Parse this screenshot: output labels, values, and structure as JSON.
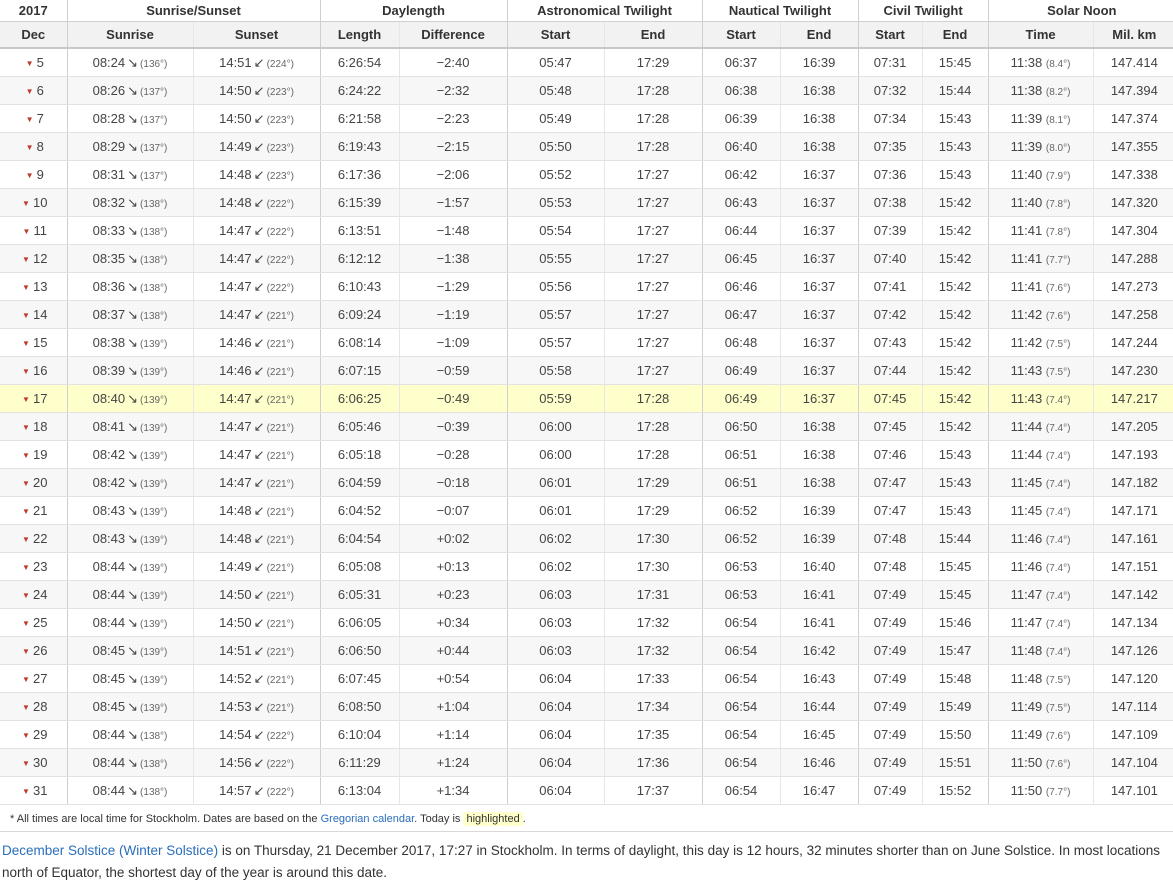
{
  "header": {
    "year": "2017",
    "groups": [
      "Sunrise/Sunset",
      "Daylength",
      "Astronomical Twilight",
      "Nautical Twilight",
      "Civil Twilight",
      "Solar Noon"
    ],
    "month": "Dec",
    "cols": [
      "Sunrise",
      "Sunset",
      "Length",
      "Difference",
      "Start",
      "End",
      "Start",
      "End",
      "Start",
      "End",
      "Time",
      "Mil. km"
    ]
  },
  "rows": [
    {
      "day": "5",
      "sr": "08:24",
      "srd": "(136°)",
      "ss": "14:51",
      "ssd": "(224°)",
      "len": "6:26:54",
      "diff": "−2:40",
      "as": "05:47",
      "ae": "17:29",
      "ns": "06:37",
      "ne": "16:39",
      "cs": "07:31",
      "ce": "15:45",
      "noon": "11:38",
      "nd": "(8.4°)",
      "km": "147.414"
    },
    {
      "day": "6",
      "sr": "08:26",
      "srd": "(137°)",
      "ss": "14:50",
      "ssd": "(223°)",
      "len": "6:24:22",
      "diff": "−2:32",
      "as": "05:48",
      "ae": "17:28",
      "ns": "06:38",
      "ne": "16:38",
      "cs": "07:32",
      "ce": "15:44",
      "noon": "11:38",
      "nd": "(8.2°)",
      "km": "147.394"
    },
    {
      "day": "7",
      "sr": "08:28",
      "srd": "(137°)",
      "ss": "14:50",
      "ssd": "(223°)",
      "len": "6:21:58",
      "diff": "−2:23",
      "as": "05:49",
      "ae": "17:28",
      "ns": "06:39",
      "ne": "16:38",
      "cs": "07:34",
      "ce": "15:43",
      "noon": "11:39",
      "nd": "(8.1°)",
      "km": "147.374"
    },
    {
      "day": "8",
      "sr": "08:29",
      "srd": "(137°)",
      "ss": "14:49",
      "ssd": "(223°)",
      "len": "6:19:43",
      "diff": "−2:15",
      "as": "05:50",
      "ae": "17:28",
      "ns": "06:40",
      "ne": "16:38",
      "cs": "07:35",
      "ce": "15:43",
      "noon": "11:39",
      "nd": "(8.0°)",
      "km": "147.355"
    },
    {
      "day": "9",
      "sr": "08:31",
      "srd": "(137°)",
      "ss": "14:48",
      "ssd": "(223°)",
      "len": "6:17:36",
      "diff": "−2:06",
      "as": "05:52",
      "ae": "17:27",
      "ns": "06:42",
      "ne": "16:37",
      "cs": "07:36",
      "ce": "15:43",
      "noon": "11:40",
      "nd": "(7.9°)",
      "km": "147.338"
    },
    {
      "day": "10",
      "sr": "08:32",
      "srd": "(138°)",
      "ss": "14:48",
      "ssd": "(222°)",
      "len": "6:15:39",
      "diff": "−1:57",
      "as": "05:53",
      "ae": "17:27",
      "ns": "06:43",
      "ne": "16:37",
      "cs": "07:38",
      "ce": "15:42",
      "noon": "11:40",
      "nd": "(7.8°)",
      "km": "147.320"
    },
    {
      "day": "11",
      "sr": "08:33",
      "srd": "(138°)",
      "ss": "14:47",
      "ssd": "(222°)",
      "len": "6:13:51",
      "diff": "−1:48",
      "as": "05:54",
      "ae": "17:27",
      "ns": "06:44",
      "ne": "16:37",
      "cs": "07:39",
      "ce": "15:42",
      "noon": "11:41",
      "nd": "(7.8°)",
      "km": "147.304"
    },
    {
      "day": "12",
      "sr": "08:35",
      "srd": "(138°)",
      "ss": "14:47",
      "ssd": "(222°)",
      "len": "6:12:12",
      "diff": "−1:38",
      "as": "05:55",
      "ae": "17:27",
      "ns": "06:45",
      "ne": "16:37",
      "cs": "07:40",
      "ce": "15:42",
      "noon": "11:41",
      "nd": "(7.7°)",
      "km": "147.288"
    },
    {
      "day": "13",
      "sr": "08:36",
      "srd": "(138°)",
      "ss": "14:47",
      "ssd": "(222°)",
      "len": "6:10:43",
      "diff": "−1:29",
      "as": "05:56",
      "ae": "17:27",
      "ns": "06:46",
      "ne": "16:37",
      "cs": "07:41",
      "ce": "15:42",
      "noon": "11:41",
      "nd": "(7.6°)",
      "km": "147.273"
    },
    {
      "day": "14",
      "sr": "08:37",
      "srd": "(138°)",
      "ss": "14:47",
      "ssd": "(221°)",
      "len": "6:09:24",
      "diff": "−1:19",
      "as": "05:57",
      "ae": "17:27",
      "ns": "06:47",
      "ne": "16:37",
      "cs": "07:42",
      "ce": "15:42",
      "noon": "11:42",
      "nd": "(7.6°)",
      "km": "147.258"
    },
    {
      "day": "15",
      "sr": "08:38",
      "srd": "(139°)",
      "ss": "14:46",
      "ssd": "(221°)",
      "len": "6:08:14",
      "diff": "−1:09",
      "as": "05:57",
      "ae": "17:27",
      "ns": "06:48",
      "ne": "16:37",
      "cs": "07:43",
      "ce": "15:42",
      "noon": "11:42",
      "nd": "(7.5°)",
      "km": "147.244"
    },
    {
      "day": "16",
      "sr": "08:39",
      "srd": "(139°)",
      "ss": "14:46",
      "ssd": "(221°)",
      "len": "6:07:15",
      "diff": "−0:59",
      "as": "05:58",
      "ae": "17:27",
      "ns": "06:49",
      "ne": "16:37",
      "cs": "07:44",
      "ce": "15:42",
      "noon": "11:43",
      "nd": "(7.5°)",
      "km": "147.230"
    },
    {
      "day": "17",
      "sr": "08:40",
      "srd": "(139°)",
      "ss": "14:47",
      "ssd": "(221°)",
      "len": "6:06:25",
      "diff": "−0:49",
      "as": "05:59",
      "ae": "17:28",
      "ns": "06:49",
      "ne": "16:37",
      "cs": "07:45",
      "ce": "15:42",
      "noon": "11:43",
      "nd": "(7.4°)",
      "km": "147.217",
      "highlight": true
    },
    {
      "day": "18",
      "sr": "08:41",
      "srd": "(139°)",
      "ss": "14:47",
      "ssd": "(221°)",
      "len": "6:05:46",
      "diff": "−0:39",
      "as": "06:00",
      "ae": "17:28",
      "ns": "06:50",
      "ne": "16:38",
      "cs": "07:45",
      "ce": "15:42",
      "noon": "11:44",
      "nd": "(7.4°)",
      "km": "147.205"
    },
    {
      "day": "19",
      "sr": "08:42",
      "srd": "(139°)",
      "ss": "14:47",
      "ssd": "(221°)",
      "len": "6:05:18",
      "diff": "−0:28",
      "as": "06:00",
      "ae": "17:28",
      "ns": "06:51",
      "ne": "16:38",
      "cs": "07:46",
      "ce": "15:43",
      "noon": "11:44",
      "nd": "(7.4°)",
      "km": "147.193"
    },
    {
      "day": "20",
      "sr": "08:42",
      "srd": "(139°)",
      "ss": "14:47",
      "ssd": "(221°)",
      "len": "6:04:59",
      "diff": "−0:18",
      "as": "06:01",
      "ae": "17:29",
      "ns": "06:51",
      "ne": "16:38",
      "cs": "07:47",
      "ce": "15:43",
      "noon": "11:45",
      "nd": "(7.4°)",
      "km": "147.182"
    },
    {
      "day": "21",
      "sr": "08:43",
      "srd": "(139°)",
      "ss": "14:48",
      "ssd": "(221°)",
      "len": "6:04:52",
      "diff": "−0:07",
      "as": "06:01",
      "ae": "17:29",
      "ns": "06:52",
      "ne": "16:39",
      "cs": "07:47",
      "ce": "15:43",
      "noon": "11:45",
      "nd": "(7.4°)",
      "km": "147.171"
    },
    {
      "day": "22",
      "sr": "08:43",
      "srd": "(139°)",
      "ss": "14:48",
      "ssd": "(221°)",
      "len": "6:04:54",
      "diff": "+0:02",
      "as": "06:02",
      "ae": "17:30",
      "ns": "06:52",
      "ne": "16:39",
      "cs": "07:48",
      "ce": "15:44",
      "noon": "11:46",
      "nd": "(7.4°)",
      "km": "147.161"
    },
    {
      "day": "23",
      "sr": "08:44",
      "srd": "(139°)",
      "ss": "14:49",
      "ssd": "(221°)",
      "len": "6:05:08",
      "diff": "+0:13",
      "as": "06:02",
      "ae": "17:30",
      "ns": "06:53",
      "ne": "16:40",
      "cs": "07:48",
      "ce": "15:45",
      "noon": "11:46",
      "nd": "(7.4°)",
      "km": "147.151"
    },
    {
      "day": "24",
      "sr": "08:44",
      "srd": "(139°)",
      "ss": "14:50",
      "ssd": "(221°)",
      "len": "6:05:31",
      "diff": "+0:23",
      "as": "06:03",
      "ae": "17:31",
      "ns": "06:53",
      "ne": "16:41",
      "cs": "07:49",
      "ce": "15:45",
      "noon": "11:47",
      "nd": "(7.4°)",
      "km": "147.142"
    },
    {
      "day": "25",
      "sr": "08:44",
      "srd": "(139°)",
      "ss": "14:50",
      "ssd": "(221°)",
      "len": "6:06:05",
      "diff": "+0:34",
      "as": "06:03",
      "ae": "17:32",
      "ns": "06:54",
      "ne": "16:41",
      "cs": "07:49",
      "ce": "15:46",
      "noon": "11:47",
      "nd": "(7.4°)",
      "km": "147.134"
    },
    {
      "day": "26",
      "sr": "08:45",
      "srd": "(139°)",
      "ss": "14:51",
      "ssd": "(221°)",
      "len": "6:06:50",
      "diff": "+0:44",
      "as": "06:03",
      "ae": "17:32",
      "ns": "06:54",
      "ne": "16:42",
      "cs": "07:49",
      "ce": "15:47",
      "noon": "11:48",
      "nd": "(7.4°)",
      "km": "147.126"
    },
    {
      "day": "27",
      "sr": "08:45",
      "srd": "(139°)",
      "ss": "14:52",
      "ssd": "(221°)",
      "len": "6:07:45",
      "diff": "+0:54",
      "as": "06:04",
      "ae": "17:33",
      "ns": "06:54",
      "ne": "16:43",
      "cs": "07:49",
      "ce": "15:48",
      "noon": "11:48",
      "nd": "(7.5°)",
      "km": "147.120"
    },
    {
      "day": "28",
      "sr": "08:45",
      "srd": "(139°)",
      "ss": "14:53",
      "ssd": "(221°)",
      "len": "6:08:50",
      "diff": "+1:04",
      "as": "06:04",
      "ae": "17:34",
      "ns": "06:54",
      "ne": "16:44",
      "cs": "07:49",
      "ce": "15:49",
      "noon": "11:49",
      "nd": "(7.5°)",
      "km": "147.114"
    },
    {
      "day": "29",
      "sr": "08:44",
      "srd": "(138°)",
      "ss": "14:54",
      "ssd": "(222°)",
      "len": "6:10:04",
      "diff": "+1:14",
      "as": "06:04",
      "ae": "17:35",
      "ns": "06:54",
      "ne": "16:45",
      "cs": "07:49",
      "ce": "15:50",
      "noon": "11:49",
      "nd": "(7.6°)",
      "km": "147.109"
    },
    {
      "day": "30",
      "sr": "08:44",
      "srd": "(138°)",
      "ss": "14:56",
      "ssd": "(222°)",
      "len": "6:11:29",
      "diff": "+1:24",
      "as": "06:04",
      "ae": "17:36",
      "ns": "06:54",
      "ne": "16:46",
      "cs": "07:49",
      "ce": "15:51",
      "noon": "11:50",
      "nd": "(7.6°)",
      "km": "147.104"
    },
    {
      "day": "31",
      "sr": "08:44",
      "srd": "(138°)",
      "ss": "14:57",
      "ssd": "(222°)",
      "len": "6:13:04",
      "diff": "+1:34",
      "as": "06:04",
      "ae": "17:37",
      "ns": "06:54",
      "ne": "16:47",
      "cs": "07:49",
      "ce": "15:52",
      "noon": "11:50",
      "nd": "(7.7°)",
      "km": "147.101"
    }
  ],
  "footnote": {
    "pre": "* All times are local time for Stockholm. Dates are based on the ",
    "link": "Gregorian calendar",
    "mid": ". Today is ",
    "highlighted": "highlighted",
    "post": "."
  },
  "paragraph": {
    "link": "December Solstice (Winter Solstice)",
    "text": " is on Thursday, 21 December 2017, 17:27 in Stockholm. In terms of daylight, this day is 12 hours, 32 minutes shorter than on June Solstice. In most locations north of Equator, the shortest day of the year is around this date."
  },
  "colors": {
    "highlight": "#ffffcc",
    "link": "#2a6ebb",
    "arrow": "#c0392b"
  }
}
